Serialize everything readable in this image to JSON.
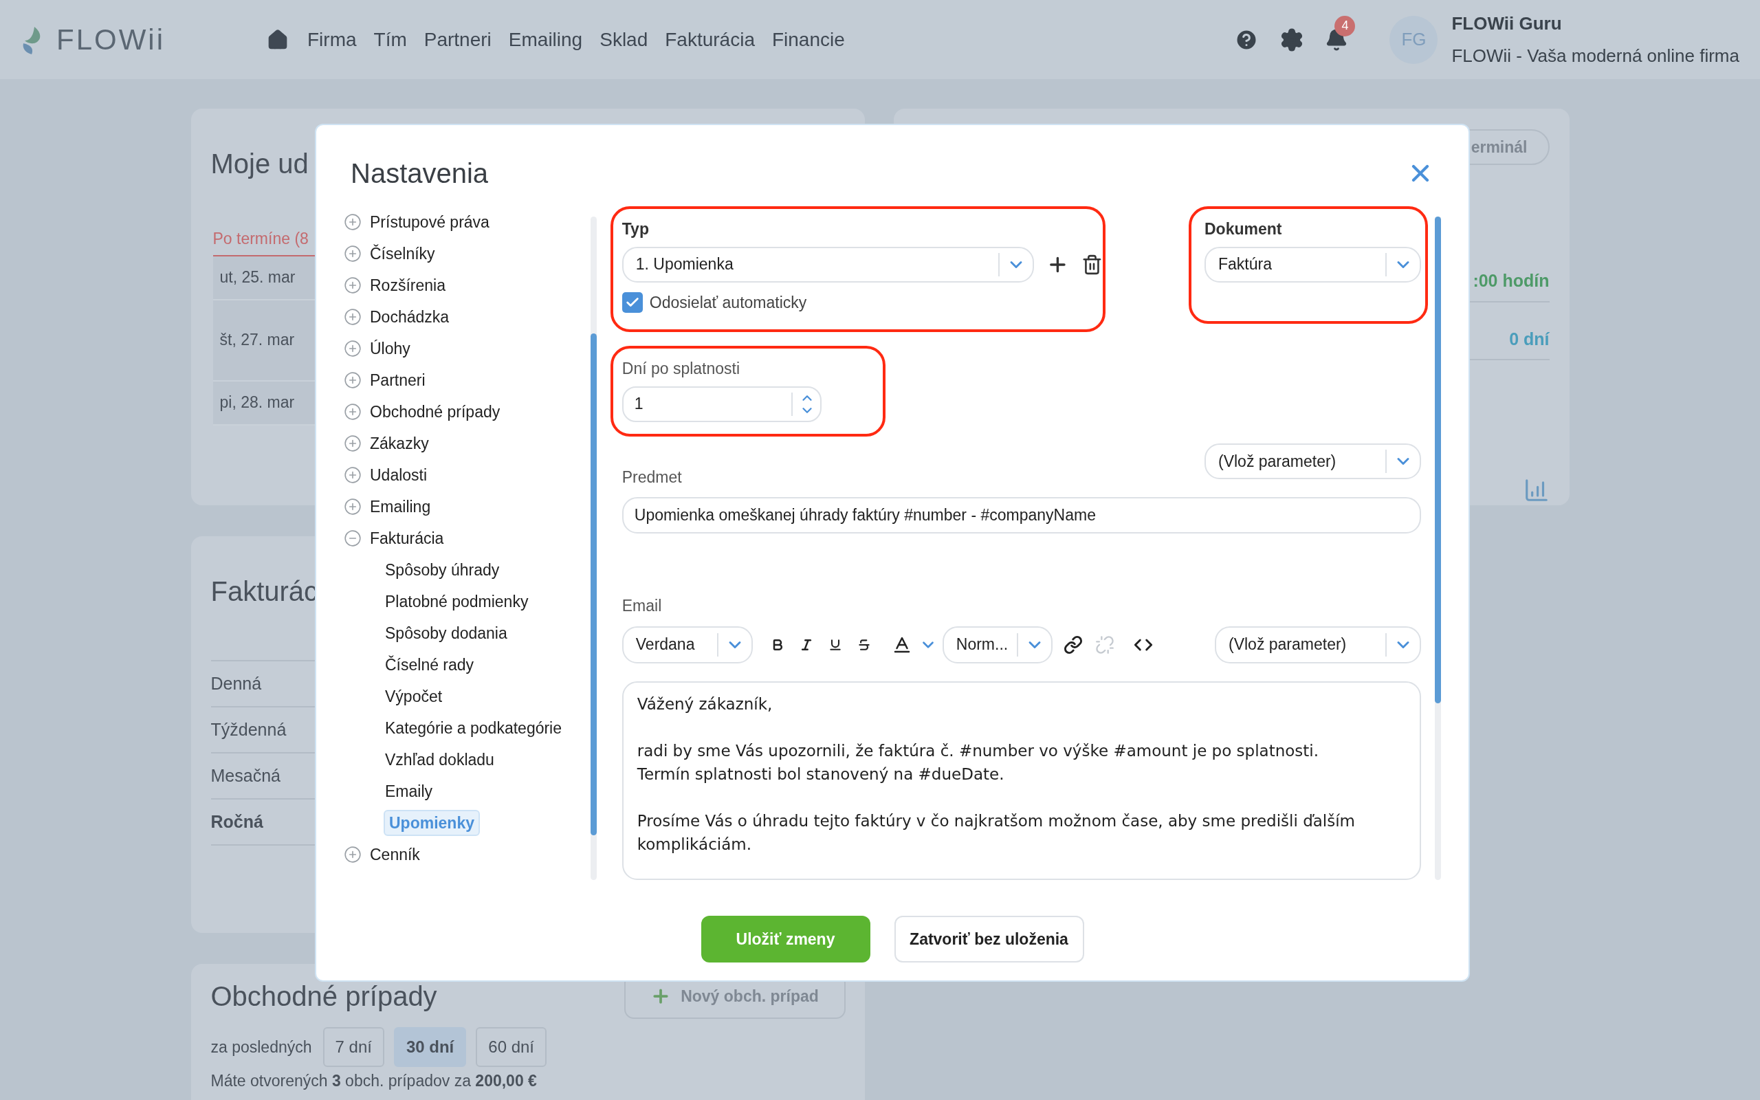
{
  "header": {
    "logo": "FLOWii",
    "nav": [
      "Firma",
      "Tím",
      "Partneri",
      "Emailing",
      "Sklad",
      "Fakturácia",
      "Financie"
    ],
    "notification_count": "4",
    "avatar": "FG",
    "user_name": "FLOWii Guru",
    "company": "FLOWii - Vaša moderná online firma"
  },
  "events_card": {
    "title": "Moje ud",
    "tab": "Po termíne (8",
    "dates": [
      "ut, 25. mar",
      "št, 27. mar",
      "pi, 28. mar"
    ]
  },
  "stats_card": {
    "button": "erminál",
    "hours": ":00 hodín",
    "days": "0 dní"
  },
  "invoicing_card": {
    "title": "Fakturác",
    "periods": [
      {
        "label": "Denná",
        "selected": false
      },
      {
        "label": "Týždenná",
        "selected": false
      },
      {
        "label": "Mesačná",
        "selected": false
      },
      {
        "label": "Ročná",
        "selected": true
      }
    ]
  },
  "deals_card": {
    "title": "Obchodné prípady",
    "new_button": "Nový obch. prípad",
    "range_label": "za posledných",
    "ranges": [
      {
        "label": "7 dní",
        "selected": false
      },
      {
        "label": "30 dní",
        "selected": true
      },
      {
        "label": "60 dní",
        "selected": false
      }
    ],
    "summary": "Máte otvorených **3** obch. prípadov za **200,00 €**"
  },
  "modal": {
    "title": "Nastavenia",
    "tree": [
      {
        "label": "Prístupové práva",
        "expanded": false
      },
      {
        "label": "Číselníky",
        "expanded": false
      },
      {
        "label": "Rozšírenia",
        "expanded": false
      },
      {
        "label": "Dochádzka",
        "expanded": false
      },
      {
        "label": "Úlohy",
        "expanded": false
      },
      {
        "label": "Partneri",
        "expanded": false
      },
      {
        "label": "Obchodné prípady",
        "expanded": false
      },
      {
        "label": "Zákazky",
        "expanded": false
      },
      {
        "label": "Udalosti",
        "expanded": false
      },
      {
        "label": "Emailing",
        "expanded": false
      },
      {
        "label": "Fakturácia",
        "expanded": true,
        "children": [
          {
            "label": "Spôsoby úhrady",
            "selected": false
          },
          {
            "label": "Platobné podmienky",
            "selected": false
          },
          {
            "label": "Spôsoby dodania",
            "selected": false
          },
          {
            "label": "Číselné rady",
            "selected": false
          },
          {
            "label": "Výpočet",
            "selected": false
          },
          {
            "label": "Kategórie a podkategórie",
            "selected": false
          },
          {
            "label": "Vzhľad dokladu",
            "selected": false
          },
          {
            "label": "Emaily",
            "selected": false
          },
          {
            "label": "Upomienky",
            "selected": true
          }
        ]
      },
      {
        "label": "Cenník",
        "expanded": false
      }
    ],
    "type": {
      "label": "Typ",
      "value": "1. Upomienka",
      "auto_send": {
        "label": "Odosielať automaticky",
        "checked": true
      }
    },
    "document": {
      "label": "Dokument",
      "value": "Faktúra"
    },
    "days_after_due": {
      "label": "Dní po splatnosti",
      "value": "1"
    },
    "subject": {
      "label": "Predmet",
      "parameter": "(Vlož parameter)",
      "value": "Upomienka omeškanej úhrady faktúry #number - #companyName"
    },
    "email": {
      "label": "Email",
      "font": "Verdana",
      "size": "Norm...",
      "parameter": "(Vlož parameter)",
      "paragraphs": [
        [
          "Vážený zákazník,"
        ],
        [
          "radi by sme Vás upozornili, že faktúra č. #number vo výške #amount je po splatnosti.",
          "Termín splatnosti bol stanovený na #dueDate."
        ],
        [
          "Prosíme Vás o úhradu tejto faktúry v čo najkratšom možnom čase, aby sme predišli ďalším komplikáciám."
        ]
      ]
    },
    "buttons": {
      "save": "Uložiť zmeny",
      "cancel": "Zatvoriť bez uloženia"
    }
  }
}
